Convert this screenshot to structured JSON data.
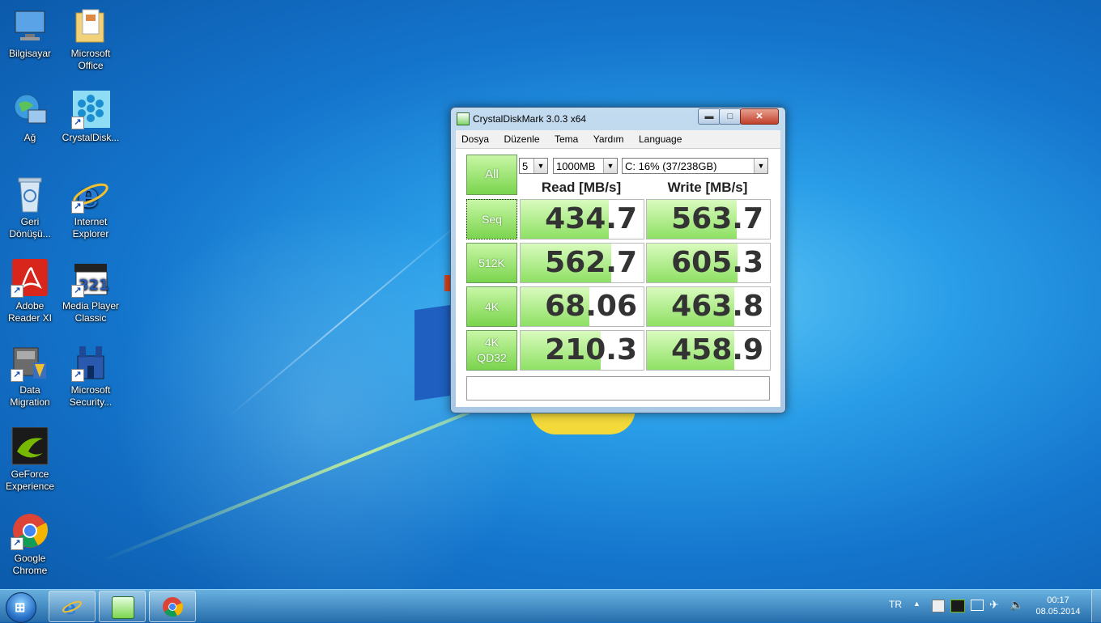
{
  "desktop": {
    "icons": [
      {
        "label": "Bilgisayar",
        "icon": "computer-icon"
      },
      {
        "label": "Microsoft Office",
        "icon": "folder-icon"
      },
      {
        "label": "Ağ",
        "icon": "network-icon"
      },
      {
        "label": "CrystalDisk...",
        "icon": "crystaldisk-icon"
      },
      {
        "label": "Geri Dönüşü...",
        "icon": "recycle-bin-icon"
      },
      {
        "label": "Internet Explorer",
        "icon": "ie-icon"
      },
      {
        "label": "Adobe Reader XI",
        "icon": "pdf-icon"
      },
      {
        "label": "Media Player Classic",
        "icon": "media-player-icon"
      },
      {
        "label": "Data Migration",
        "icon": "data-migration-icon"
      },
      {
        "label": "Microsoft Security...",
        "icon": "security-icon"
      },
      {
        "label": "GeForce Experience",
        "icon": "geforce-icon"
      },
      {
        "label": "Google Chrome",
        "icon": "chrome-icon"
      }
    ]
  },
  "window": {
    "title": "CrystalDiskMark 3.0.3 x64",
    "controls": {
      "minimize": "▬",
      "maximize": "□",
      "close": "✕"
    },
    "menu": [
      "Dosya",
      "Düzenle",
      "Tema",
      "Yardım",
      "Language"
    ],
    "all_button": "All",
    "count_select": "5",
    "size_select": "1000MB",
    "drive_select": "C: 16% (37/238GB)",
    "read_header": "Read [MB/s]",
    "write_header": "Write [MB/s]",
    "rows": [
      {
        "label": "Seq",
        "read": "434.7",
        "write": "563.7",
        "read_fill": 0.72,
        "write_fill": 0.73
      },
      {
        "label": "512K",
        "read": "562.7",
        "write": "605.3",
        "read_fill": 0.74,
        "write_fill": 0.74
      },
      {
        "label": "4K",
        "read": "68.06",
        "write": "463.8",
        "read_fill": 0.56,
        "write_fill": 0.71
      },
      {
        "label": "4K\nQD32",
        "read": "210.3",
        "write": "458.9",
        "read_fill": 0.65,
        "write_fill": 0.71
      }
    ],
    "comment": ""
  },
  "taskbar": {
    "start_label": "Start",
    "apps": [
      "Internet Explorer",
      "CrystalDiskMark",
      "Google Chrome"
    ],
    "language": "TR",
    "time": "00:17",
    "date": "08.05.2014"
  }
}
